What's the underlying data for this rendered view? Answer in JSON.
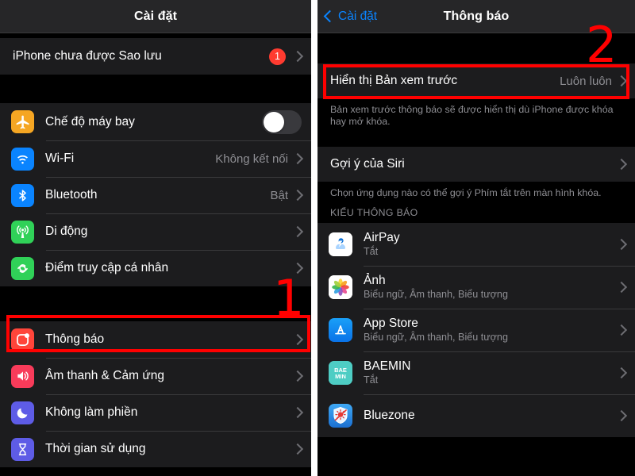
{
  "left_screen": {
    "nav": {
      "title": "Cài đặt"
    },
    "backup_row": {
      "label": "iPhone chưa được Sao lưu",
      "badge": "1"
    },
    "connectivity": [
      {
        "label": "Chế độ máy bay",
        "icon": "airplane-icon",
        "control": "toggle",
        "toggle_on": false,
        "value": ""
      },
      {
        "label": "Wi-Fi",
        "icon": "wifi-icon",
        "control": "chevron",
        "value": "Không kết nối"
      },
      {
        "label": "Bluetooth",
        "icon": "bluetooth-icon",
        "control": "chevron",
        "value": "Bật"
      },
      {
        "label": "Di động",
        "icon": "cellular-icon",
        "control": "chevron",
        "value": ""
      },
      {
        "label": "Điểm truy cập cá nhân",
        "icon": "hotspot-icon",
        "control": "chevron",
        "value": ""
      }
    ],
    "notifications_group": [
      {
        "label": "Thông báo",
        "icon": "notifications-icon",
        "control": "chevron",
        "value": "",
        "highlighted": true
      },
      {
        "label": "Âm thanh & Cảm ứng",
        "icon": "sounds-icon",
        "control": "chevron",
        "value": ""
      },
      {
        "label": "Không làm phiền",
        "icon": "do-not-disturb-icon",
        "control": "chevron",
        "value": ""
      },
      {
        "label": "Thời gian sử dụng",
        "icon": "screen-time-icon",
        "control": "chevron",
        "value": ""
      }
    ]
  },
  "right_screen": {
    "nav": {
      "back_label": "Cài đặt",
      "title": "Thông báo"
    },
    "show_previews": {
      "label": "Hiển thị Bản xem trước",
      "value": "Luôn luôn"
    },
    "show_previews_footnote": "Bản xem trước thông báo sẽ được hiển thị dù iPhone được khóa hay mở khóa.",
    "siri_row": {
      "label": "Gợi ý của Siri",
      "value": ""
    },
    "siri_footnote": "Chọn ứng dụng nào có thể gợi ý Phím tắt trên màn hình khóa.",
    "section_header": "KIỂU THÔNG BÁO",
    "apps": [
      {
        "name": "AirPay",
        "status": "Tắt",
        "icon": "airpay-icon"
      },
      {
        "name": "Ảnh",
        "status": "Biểu ngữ, Âm thanh, Biểu tượng",
        "icon": "photos-icon"
      },
      {
        "name": "App Store",
        "status": "Biểu ngữ, Âm thanh, Biểu tượng",
        "icon": "appstore-icon"
      },
      {
        "name": "BAEMIN",
        "status": "Tắt",
        "icon": "baemin-icon"
      },
      {
        "name": "Bluezone",
        "status": "",
        "icon": "bluezone-icon"
      }
    ]
  },
  "annotations": {
    "marker_one": "1",
    "marker_two": "2",
    "highlight_color": "#ff0000"
  }
}
